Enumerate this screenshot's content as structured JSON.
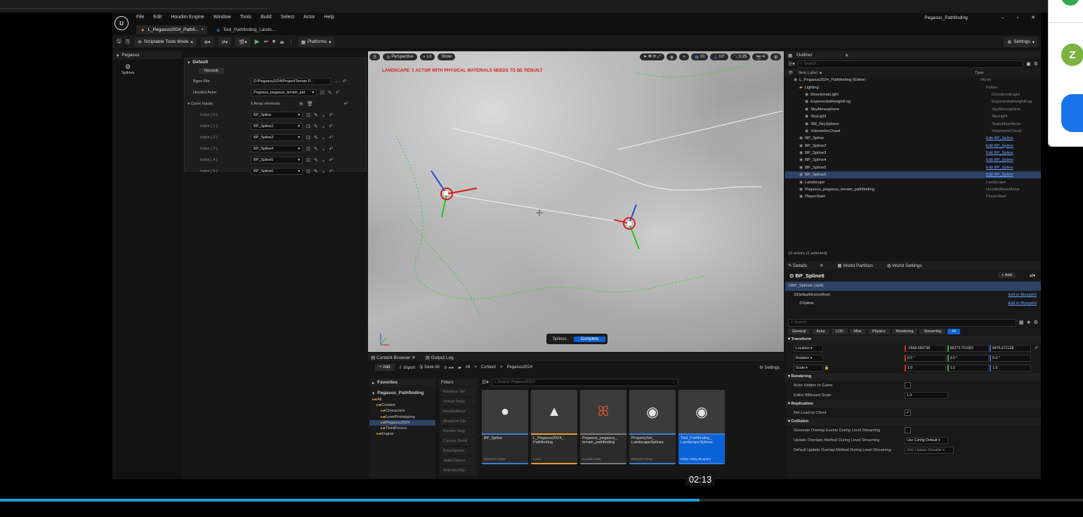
{
  "window": {
    "title": "Pegasus_Pathfinding",
    "menu": [
      "File",
      "Edit",
      "Houdini Engine",
      "Window",
      "Tools",
      "Build",
      "Select",
      "Actor",
      "Help"
    ],
    "tabs": [
      {
        "label": "L_Pegasus2024_Pathfi..."
      },
      {
        "label": "Tool_Pathfinding_Lands..."
      }
    ],
    "controls": [
      "–",
      "▫",
      "✕"
    ]
  },
  "toolbar": {
    "mode": "Scriptable Tools Mode",
    "platforms": "Platforms",
    "settings": "Settings"
  },
  "left_panel": {
    "title": "Pegasus",
    "item": "Splines"
  },
  "details_panel": {
    "section": "Default",
    "recook": "Recook",
    "rows": [
      {
        "label": "Bgeo File",
        "value": "D:/Pegasus2024/Project/Terrain P..."
      },
      {
        "label": "Houdini Actor",
        "value": "Pegasus_pegasus_terrain_pat"
      },
      {
        "label": "Curve Inputs",
        "value": "6 Array elements"
      }
    ],
    "indices": [
      {
        "label": "Index [ 0 ]",
        "value": "BP_Spline"
      },
      {
        "label": "Index [ 1 ]",
        "value": "BP_Spline2"
      },
      {
        "label": "Index [ 2 ]",
        "value": "BP_Spline3"
      },
      {
        "label": "Index [ 3 ]",
        "value": "BP_Spline4"
      },
      {
        "label": "Index [ 4 ]",
        "value": "BP_Spline5"
      },
      {
        "label": "Index [ 5 ]",
        "value": "BP_Spline6"
      }
    ]
  },
  "viewport": {
    "perspective": "Perspective",
    "lit": "Lit",
    "show": "Show",
    "warning": "LANDSCAPE: 1 ACTOR WITH PHYSICAL MATERIALS NEEDS TO BE REBUILT",
    "grid": "10",
    "angle": "10°",
    "scale": "0.25",
    "cam": "4",
    "bottom_left": "Splines",
    "bottom_right": "Complete"
  },
  "outliner": {
    "tab": "Outliner",
    "search": "Search...",
    "col_label": "Item Label ▲",
    "col_type": "Type",
    "items": [
      {
        "label": "L_Pegasus2024_Pathfinding (Editor)",
        "type": "World",
        "indent": 1,
        "selected": false,
        "link": false
      },
      {
        "label": "Lighting",
        "type": "Folder",
        "indent": 2,
        "selected": false,
        "link": false
      },
      {
        "label": "DirectionalLight",
        "type": "DirectionalLight",
        "indent": 3,
        "selected": false,
        "link": false
      },
      {
        "label": "ExponentialHeightFog",
        "type": "ExponentialHeightFog",
        "indent": 3,
        "selected": false,
        "link": false
      },
      {
        "label": "SkyAtmosphere",
        "type": "SkyAtmosphere",
        "indent": 3,
        "selected": false,
        "link": false
      },
      {
        "label": "SkyLight",
        "type": "SkyLight",
        "indent": 3,
        "selected": false,
        "link": false
      },
      {
        "label": "SM_SkySphere",
        "type": "StaticMeshActor",
        "indent": 3,
        "selected": false,
        "link": false
      },
      {
        "label": "VolumetricCloud",
        "type": "VolumetricCloud",
        "indent": 3,
        "selected": false,
        "link": false
      },
      {
        "label": "BP_Spline",
        "type": "Edit BP_Spline",
        "indent": 2,
        "selected": false,
        "link": true
      },
      {
        "label": "BP_Spline2",
        "type": "Edit BP_Spline",
        "indent": 2,
        "selected": false,
        "link": true
      },
      {
        "label": "BP_Spline3",
        "type": "Edit BP_Spline",
        "indent": 2,
        "selected": false,
        "link": true
      },
      {
        "label": "BP_Spline4",
        "type": "Edit BP_Spline",
        "indent": 2,
        "selected": false,
        "link": true
      },
      {
        "label": "BP_Spline5",
        "type": "Edit BP_Spline",
        "indent": 2,
        "selected": false,
        "link": true
      },
      {
        "label": "BP_Spline6",
        "type": "Edit BP_Spline",
        "indent": 2,
        "selected": true,
        "link": true
      },
      {
        "label": "Landscape",
        "type": "Landscape",
        "indent": 2,
        "selected": false,
        "link": false
      },
      {
        "label": "Pegasus_pegasus_terrain_pathfinding",
        "type": "HoudiniAssetActor",
        "indent": 2,
        "selected": false,
        "link": false
      },
      {
        "label": "PlayerStart",
        "type": "PlayerStart",
        "indent": 2,
        "selected": false,
        "link": false
      }
    ],
    "status": "15 actors (1 selected)"
  },
  "details_right": {
    "tabs": [
      "Details",
      "World Partition",
      "World Settings"
    ],
    "actor": "BP_Spline6",
    "add": "+ Add",
    "components": [
      {
        "label": "BP_Spline6 (Self)",
        "action": ""
      },
      {
        "label": "DefaultSceneRoot",
        "action": "Edit in Blueprint"
      },
      {
        "label": "Spline",
        "action": "Edit in Blueprint"
      }
    ],
    "search": "Search",
    "filters": [
      "General",
      "Actor",
      "LOD",
      "Misc",
      "Physics",
      "Rendering",
      "Streaming",
      "All"
    ],
    "transform": {
      "title": "Transform",
      "location": {
        "label": "Location",
        "x": "-2668.550738",
        "y": "96273.701083",
        "z": "8475.672128"
      },
      "rotation": {
        "label": "Rotation",
        "x": "0.0 °",
        "y": "0.0 °",
        "z": "0.0 °"
      },
      "scale": {
        "label": "Scale",
        "x": "1.0",
        "y": "1.0",
        "z": "1.0"
      }
    },
    "rendering": {
      "title": "Rendering",
      "hidden": "Actor Hidden In Game",
      "billboard": "Editor Billboard Scale",
      "billboard_value": "1.0"
    },
    "replication": {
      "title": "Replication",
      "net_load": "Net Load on Client"
    },
    "collision": {
      "title": "Collision",
      "gen": "Generate Overlap Events During Level Streaming",
      "upd": "Update Overlaps Method During Level Streaming",
      "upd_val": "Use Config Default",
      "def": "Default Update Overlap Method During Level Streaming",
      "def_val": "Only Update Movable"
    }
  },
  "content_browser": {
    "tabs": [
      "Content Browser",
      "Output Log"
    ],
    "add": "+ Add",
    "import": "Import",
    "save_all": "Save All",
    "path": [
      "All",
      "Content",
      "Pegasus2024"
    ],
    "settings": "Settings",
    "favorites": "Favorites",
    "project": "Pegasus_Pathfinding",
    "tree": [
      {
        "label": "All",
        "indent": 0,
        "sel": false
      },
      {
        "label": "Content",
        "indent": 1,
        "sel": false
      },
      {
        "label": "Characters",
        "indent": 2,
        "sel": false
      },
      {
        "label": "LevelPrototyping",
        "indent": 2,
        "sel": false
      },
      {
        "label": "Pegasus2024",
        "indent": 2,
        "sel": true
      },
      {
        "label": "ThirdPerson",
        "indent": 2,
        "sel": false
      },
      {
        "label": "Engine",
        "indent": 1,
        "sel": false
      }
    ],
    "filters_title": "Filters",
    "filters": [
      "Runtime Virt",
      "Virtual Textu",
      "HoudiniAsse",
      "Blueprint Cla",
      "Render Targ",
      "Canvas Rend",
      "BaseSparse",
      "StaticSparse",
      "AnimatedSp"
    ],
    "search": "Search Pegasus2024",
    "assets": [
      {
        "name": "BP_Spline",
        "type": "Blueprint Class",
        "accent": "#3f7bd8",
        "sel": false
      },
      {
        "name": "L_Pegasus2024_ Pathfinding",
        "type": "Level",
        "accent": "#e79a2e",
        "sel": false
      },
      {
        "name": "Pegasus_pegasus_ terrain_pathfinding",
        "type": "HoudiniAsset",
        "accent": "#7a7a7a",
        "sel": false
      },
      {
        "name": "PropertySet_ LandscapeSplines",
        "type": "Blueprint Class",
        "accent": "#3f7bd8",
        "sel": false
      },
      {
        "name": "Tool_Pathfinding_ LandscapeSplines",
        "type": "Editor Utility Blueprint",
        "accent": "#3f7bd8",
        "sel": true
      }
    ]
  },
  "video": {
    "time": "02:13",
    "progress": 0.646
  },
  "side_panel": {
    "avatar_letter": "Z",
    "colors": {
      "green": "#7cb342",
      "blue": "#1a73e8"
    }
  }
}
